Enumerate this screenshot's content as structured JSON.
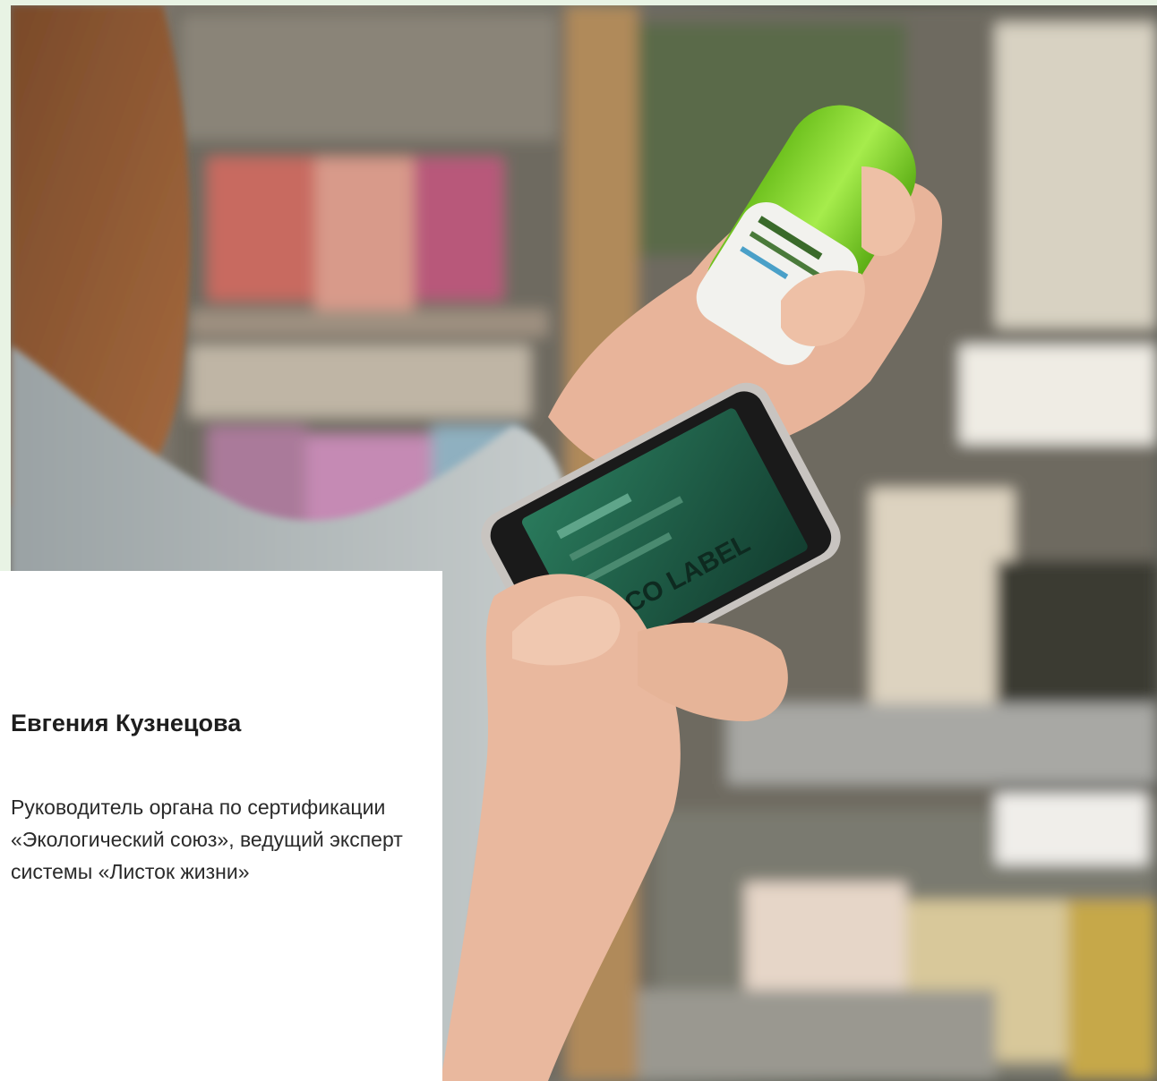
{
  "profile": {
    "name": "Евгения Кузнецова",
    "role": "Руководитель органа по сертификации «Экологический союз», ведущий эксперт системы «Листок жизни»"
  },
  "photo": {
    "subject": "woman-scanning-product-with-smartphone",
    "bottle_color": "#8fdc3a",
    "phone_screen_color": "#1f6b4e",
    "phone_screen_text": "ECO LABEL"
  },
  "colors": {
    "page_background": "#e8f3e4",
    "card_background": "#ffffff",
    "text": "#1e1e1e"
  }
}
